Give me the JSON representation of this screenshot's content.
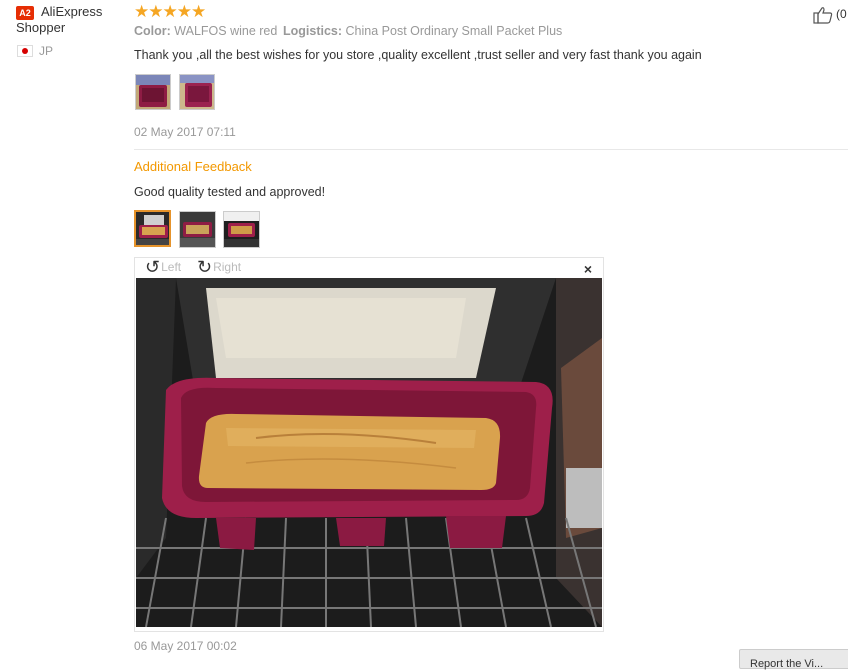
{
  "user": {
    "badge": "A2",
    "name_line1": "AliExpress",
    "name_line2": "Shopper",
    "country": "JP"
  },
  "review": {
    "rating": 5,
    "stars": "★★★★★",
    "color_label": "Color:",
    "color_value": "WALFOS wine red",
    "logistics_label": "Logistics:",
    "logistics_value": "China Post Ordinary Small Packet Plus",
    "text": "Thank you ,all the best wishes for you store ,quality excellent ,trust seller and very fast thank you again",
    "date": "02 May 2017 07:11",
    "helpful_count": "(0"
  },
  "additional": {
    "heading": "Additional Feedback",
    "text": "Good quality tested and approved!",
    "date": "06 May 2017 00:02"
  },
  "viewer": {
    "rotate_left": "Left",
    "rotate_right": "Right",
    "close": "×"
  },
  "colors": {
    "accent_orange": "#f39800",
    "star_color": "#f5a623",
    "badge_red": "#e62e04",
    "mold_wine": "#9e1f4a"
  },
  "footer": {
    "corner_button": "Report the Vi..."
  }
}
